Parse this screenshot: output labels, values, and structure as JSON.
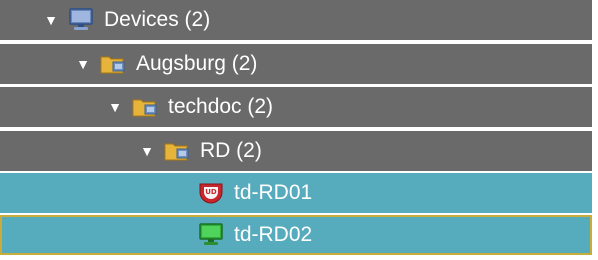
{
  "tree": {
    "nodes": [
      {
        "label": "Devices (2)",
        "icon": "monitor-icon",
        "expanded": true
      },
      {
        "label": "Augsburg (2)",
        "icon": "folder-icon",
        "expanded": true
      },
      {
        "label": "techdoc (2)",
        "icon": "folder-icon",
        "expanded": true
      },
      {
        "label": "RD (2)",
        "icon": "folder-icon",
        "expanded": true
      },
      {
        "label": "td-RD01",
        "icon": "ud-device-icon",
        "status": "selected"
      },
      {
        "label": "td-RD02",
        "icon": "monitor-green-icon",
        "status": "focused"
      }
    ],
    "expander_glyph": "▼",
    "colors": {
      "row_bg": "#6a6a6a",
      "selected_bg": "#56abbd",
      "focus_border": "#c9ad3a",
      "text": "#ffffff"
    }
  }
}
